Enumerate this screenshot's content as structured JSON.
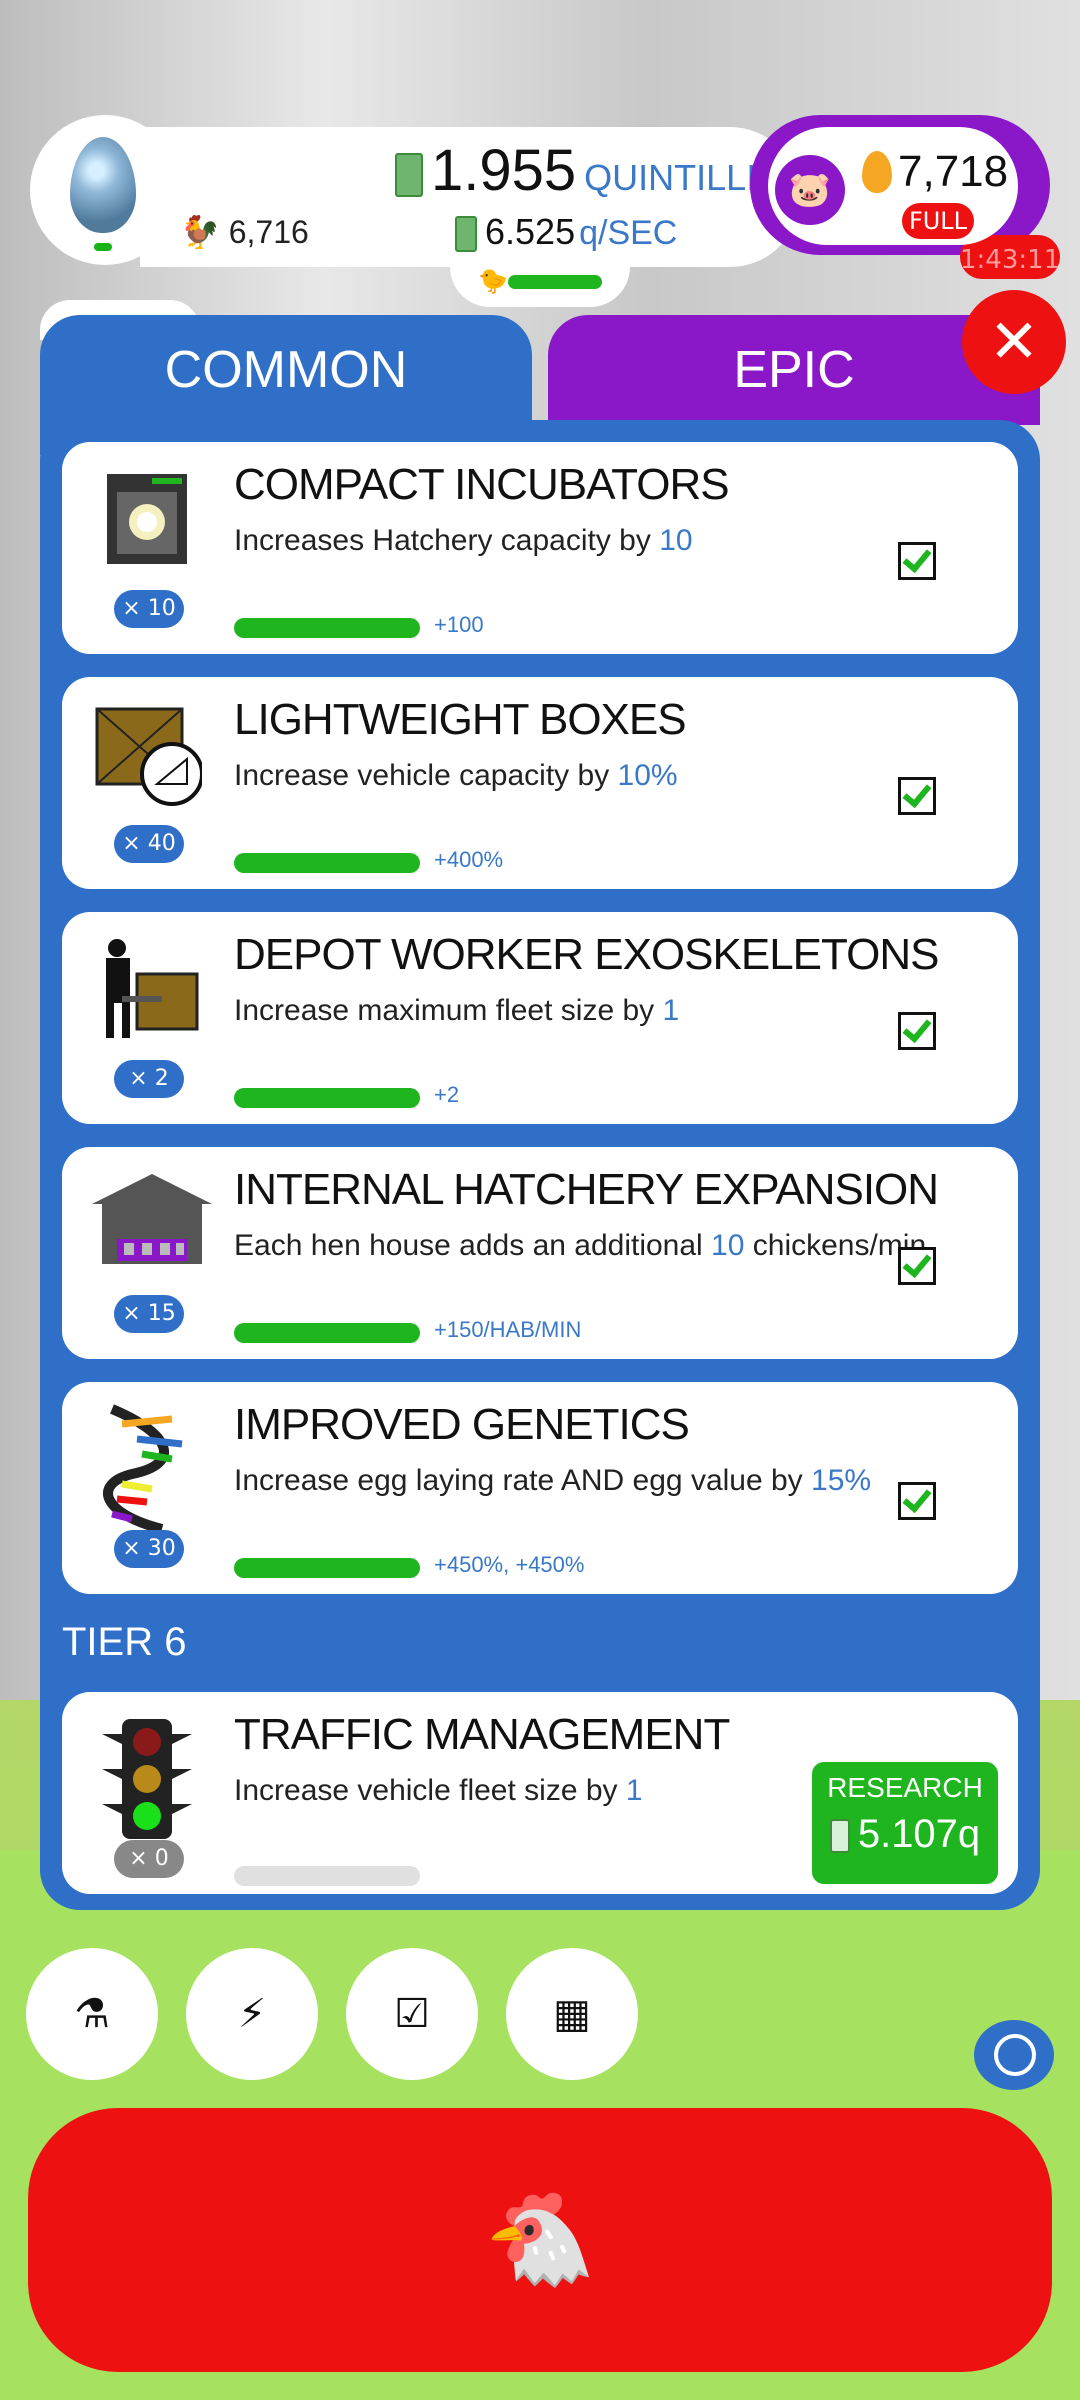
{
  "header": {
    "chicken_count": "6,716",
    "money_value": "1.955",
    "money_unit": "QUINTILLION",
    "rate_value": "6.525",
    "rate_unit": "q/SEC",
    "golden_eggs": "7,718",
    "full_badge": "FULL",
    "timer": "1:43:11"
  },
  "tabs": [
    {
      "label": "COMMON"
    },
    {
      "label": "EPIC"
    }
  ],
  "cards": [
    {
      "title": "COMPACT INCUBATORS",
      "desc_prefix": "Increases Hatchery capacity by ",
      "desc_value": "10",
      "desc_suffix": "",
      "count": "× 10",
      "bonus": "+100",
      "progress": 1.0,
      "icon": "incubator-icon"
    },
    {
      "title": "LIGHTWEIGHT BOXES",
      "desc_prefix": "Increase vehicle capacity by ",
      "desc_value": "10%",
      "desc_suffix": "",
      "count": "× 40",
      "bonus": "+400%",
      "progress": 1.0,
      "icon": "boxes-icon"
    },
    {
      "title": "DEPOT WORKER EXOSKELETONS",
      "desc_prefix": "Increase maximum fleet size by ",
      "desc_value": "1",
      "desc_suffix": "",
      "count": "× 2",
      "bonus": "+2",
      "progress": 1.0,
      "icon": "worker-icon"
    },
    {
      "title": "INTERNAL HATCHERY EXPANSION",
      "desc_prefix": "Each hen house adds an additional ",
      "desc_value": "10",
      "desc_suffix": " chickens/min",
      "count": "× 15",
      "bonus": "+150/HAB/MIN",
      "progress": 1.0,
      "icon": "hatchery-icon"
    },
    {
      "title": "IMPROVED GENETICS",
      "desc_prefix": "Increase egg laying rate AND egg value by ",
      "desc_value": "15%",
      "desc_suffix": "",
      "count": "× 30",
      "bonus": "+450%, +450%",
      "progress": 1.0,
      "icon": "dna-icon"
    }
  ],
  "tier_label": "TIER 6",
  "tier6_card": {
    "title": "TRAFFIC MANAGEMENT",
    "desc_prefix": "Increase vehicle fleet size by ",
    "desc_value": "1",
    "count": "× 0",
    "progress": 0.0,
    "research_label": "RESEARCH",
    "research_price": "5.107q",
    "icon": "traffic-light-icon"
  },
  "bottom_buttons": [
    {
      "icon": "flask-icon",
      "glyph": "⚗"
    },
    {
      "icon": "lightning-icon",
      "glyph": "⚡"
    },
    {
      "icon": "checklist-icon",
      "glyph": "☑"
    },
    {
      "icon": "grid-icon",
      "glyph": "▦"
    }
  ],
  "colors": {
    "panel_blue": "#2f6fc8",
    "epic_purple": "#8a18c8",
    "research_green": "#1fb51f",
    "alert_red": "#ee1111"
  }
}
